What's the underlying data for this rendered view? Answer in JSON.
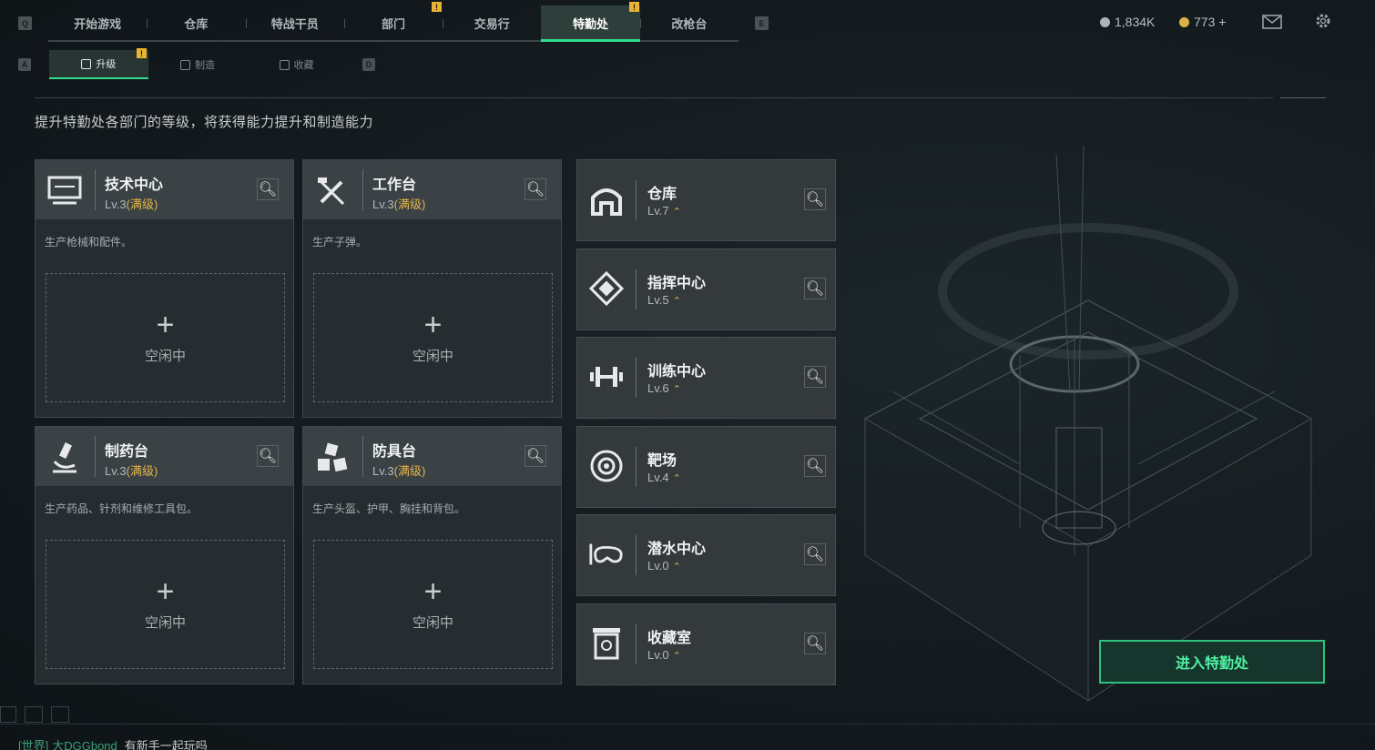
{
  "nav": {
    "left_key": "Q",
    "right_key": "E",
    "tabs": [
      {
        "label": "开始游戏"
      },
      {
        "label": "仓库"
      },
      {
        "label": "特战干员"
      },
      {
        "label": "部门",
        "badge": "!"
      },
      {
        "label": "交易行"
      },
      {
        "label": "特勤处",
        "badge": "!",
        "active": true
      },
      {
        "label": "改枪台"
      }
    ]
  },
  "subnav": {
    "left_key": "A",
    "right_key": "D",
    "tabs": [
      {
        "label": "升级",
        "badge": "!",
        "active": true
      },
      {
        "label": "制造"
      },
      {
        "label": "收藏"
      }
    ]
  },
  "currency": {
    "silver": "1,834K",
    "gold": "773 +",
    "silver_color": "#aeb4b7",
    "gold_color": "#d9b24a"
  },
  "description": "提升特勤处各部门的等级，将获得能力提升和制造能力",
  "workshops": [
    {
      "name": "技术中心",
      "level": "Lv.3",
      "max": "(满级)",
      "desc": "生产枪械和配件。",
      "slot": "空闲中",
      "icon": "computer-icon"
    },
    {
      "name": "工作台",
      "level": "Lv.3",
      "max": "(满级)",
      "desc": "生产子弹。",
      "slot": "空闲中",
      "icon": "tools-icon"
    },
    {
      "name": "制药台",
      "level": "Lv.3",
      "max": "(满级)",
      "desc": "生产药品、针剂和维修工具包。",
      "slot": "空闲中",
      "icon": "microscope-icon"
    },
    {
      "name": "防具台",
      "level": "Lv.3",
      "max": "(满级)",
      "desc": "生产头盔、护甲、胸挂和背包。",
      "slot": "空闲中",
      "icon": "boxes-icon"
    }
  ],
  "facilities": [
    {
      "name": "仓库",
      "level": "Lv.7",
      "icon": "warehouse-icon"
    },
    {
      "name": "指挥中心",
      "level": "Lv.5",
      "icon": "command-icon"
    },
    {
      "name": "训练中心",
      "level": "Lv.6",
      "icon": "dumbbell-icon"
    },
    {
      "name": "靶场",
      "level": "Lv.4",
      "icon": "target-icon"
    },
    {
      "name": "潜水中心",
      "level": "Lv.0",
      "icon": "diving-mask-icon"
    },
    {
      "name": "收藏室",
      "level": "Lv.0",
      "icon": "collection-icon"
    }
  ],
  "enter_button": "进入特勤处",
  "chat": {
    "channel": "[世界]",
    "user": "大DGGbond",
    "message": "有新手一起玩吗"
  },
  "accent_color": "#2ee08a"
}
